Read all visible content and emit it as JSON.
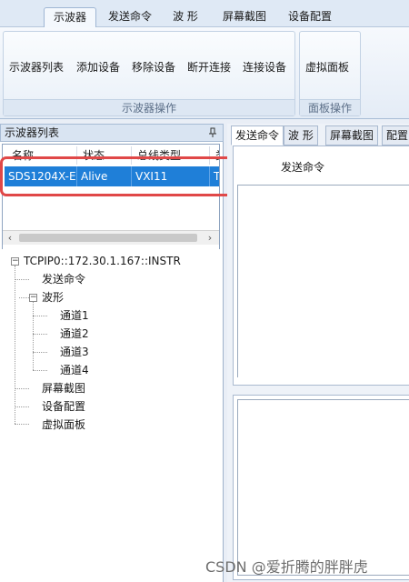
{
  "menu": {
    "tabs": [
      "示波器",
      "发送命令",
      "波 形",
      "屏幕截图",
      "设备配置"
    ],
    "active_index": 0
  },
  "ribbon": {
    "groups": [
      {
        "label": "示波器操作",
        "buttons": [
          "示波器列表",
          "添加设备",
          "移除设备",
          "断开连接",
          "连接设备"
        ]
      },
      {
        "label": "面板操作",
        "buttons": [
          "虚拟面板"
        ]
      }
    ]
  },
  "left_panel": {
    "title": "示波器列表",
    "pin_icon": "pin-icon",
    "list": {
      "columns": [
        "名称",
        "状态",
        "总线类型",
        "类"
      ],
      "rows": [
        {
          "name": "SDS1204X-E",
          "status": "Alive",
          "bus": "VXI11",
          "type": "TC"
        }
      ]
    },
    "tree": {
      "root": "TCPIP0::172.30.1.167::INSTR",
      "send_cmd": "发送命令",
      "waveform": "波形",
      "channels": [
        "通道1",
        "通道2",
        "通道3",
        "通道4"
      ],
      "screenshot": "屏幕截图",
      "config": "设备配置",
      "panel": "虚拟面板"
    }
  },
  "right_panel": {
    "tabs": [
      "发送命令",
      "波 形",
      "屏幕截图",
      "配置"
    ],
    "active_index": 0,
    "group_title": "发送命令"
  },
  "watermark": "CSDN @爱折腾的胖胖虎",
  "colors": {
    "selection": "#1f7fd8",
    "highlight": "#e04848"
  }
}
